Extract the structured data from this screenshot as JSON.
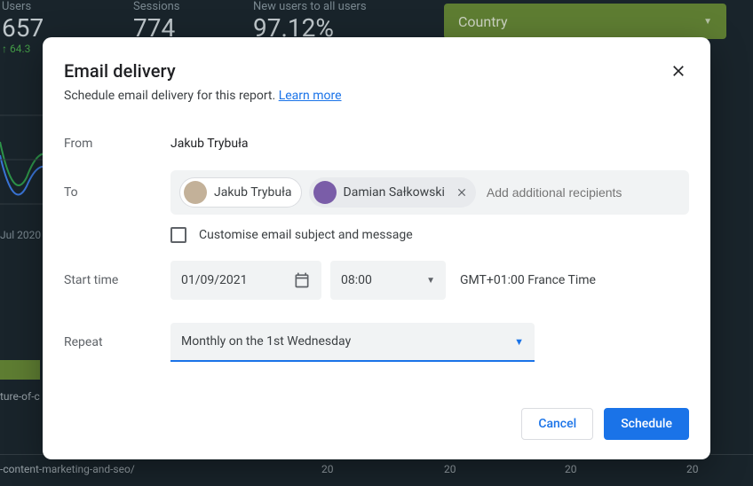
{
  "bg": {
    "stats": {
      "users": {
        "label": "Users",
        "value": "657",
        "delta": "64.3"
      },
      "sessions": {
        "label": "Sessions",
        "value": "774"
      },
      "newusers": {
        "label": "New users to all users",
        "value": "97.12%"
      }
    },
    "country_dropdown": "Country",
    "dates": {
      "jul": "Jul 2020"
    },
    "row_text": "ture-of-c",
    "bottom_path": "-content-marketing-and-seo/",
    "ticks": [
      "20",
      "20",
      "20",
      "20"
    ]
  },
  "modal": {
    "title": "Email delivery",
    "subtitle": "Schedule email delivery for this report.",
    "learn_more": "Learn more",
    "from_label": "From",
    "from_name": "Jakub Trybuła",
    "to_label": "To",
    "recipients": [
      {
        "name": "Jakub Trybuła",
        "removable": false
      },
      {
        "name": "Damian Sałkowski",
        "removable": true
      }
    ],
    "add_placeholder": "Add additional recipients",
    "customize_label": "Customise email subject and message",
    "start_label": "Start time",
    "date_value": "01/09/2021",
    "time_value": "08:00",
    "tz": "GMT+01:00 France Time",
    "repeat_label": "Repeat",
    "repeat_value": "Monthly on the 1st Wednesday",
    "cancel": "Cancel",
    "schedule": "Schedule"
  }
}
